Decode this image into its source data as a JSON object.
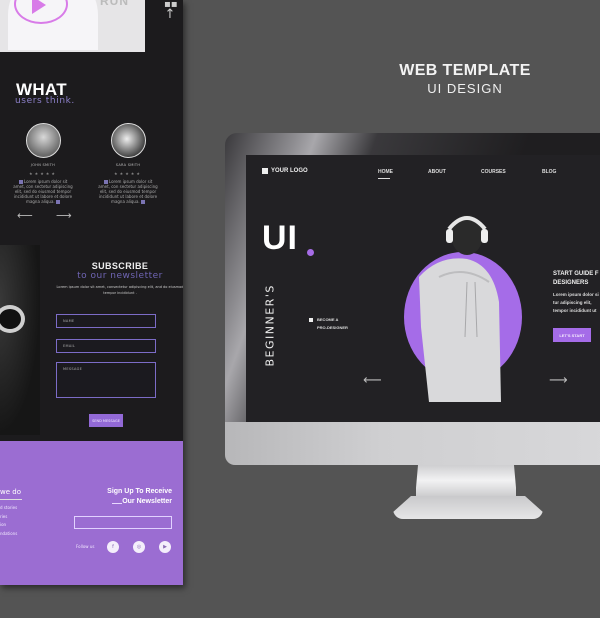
{
  "headline": {
    "title": "WEB TEMPLATE",
    "subtitle": "UI DESIGN"
  },
  "left_page": {
    "hero_ghost_text": "RUN",
    "side_icons": [
      "grid-icon",
      "arrow-up-icon"
    ],
    "testimonials": {
      "title": "WHAT",
      "subtitle": "users think.",
      "items": [
        {
          "name": "JOHN SMITH",
          "rating": 5,
          "text": "Lorem ipsum dolor sit amet, con sectetur adipiscing elit, sed do eiusmod tempor incididunt ut labore et dolore magna aliqua."
        },
        {
          "name": "SARA SMITH",
          "rating": 5,
          "text": "Lorem ipsum dolor sit amet, con sectetur adipiscing elit, sed do eiusmod tempor incididunt ut labore et dolore magna aliqua."
        }
      ],
      "prev_arrow": "⟵",
      "next_arrow": "⟶"
    },
    "subscribe": {
      "title": "SUBSCRIBE",
      "subtitle": "to our newsletter",
      "description": "Lorem ipsum dolor sit amet, consectetur adipiscing elit, and do eiusmod tempor incididunt .",
      "name_placeholder": "NAME",
      "email_placeholder": "EMAIL",
      "message_placeholder": "MESSAGE",
      "send_label": "SEND MESSAGE"
    },
    "footer": {
      "what_we_do_title": "we do",
      "what_we_do_items": [
        "d stories",
        "ries",
        "ion",
        "ndations"
      ],
      "signup_line1": "Sign Up To Receive",
      "signup_line2": "Our Newsletter",
      "follow_label": "Follow us",
      "social": [
        {
          "icon": "facebook-icon",
          "glyph": "f"
        },
        {
          "icon": "instagram-icon",
          "glyph": "◎"
        },
        {
          "icon": "youtube-icon",
          "glyph": "▶"
        }
      ]
    }
  },
  "monitor_site": {
    "logo": "YOUR LOGO",
    "nav": [
      {
        "label": "HOME",
        "active": true
      },
      {
        "label": "ABOUT",
        "active": false
      },
      {
        "label": "COURSES",
        "active": false
      },
      {
        "label": "BLOG",
        "active": false
      }
    ],
    "hero_big": "UI",
    "hero_vertical": "BEGINNER'S",
    "bullet_line1": "BECOME A",
    "bullet_line2": "PRO-DESIGNER",
    "guide_title_line1": "START GUIDE F",
    "guide_title_line2": "DESIGNERS",
    "guide_desc_line1": "Lorem ipsum dolor si",
    "guide_desc_line2": "tur adipiscing elit,",
    "guide_desc_line3": "tempor incididunt ut",
    "cta_label": "LET'S START",
    "prev_arrow": "⟵",
    "next_arrow": "⟶",
    "accent_color": "#a56ce8"
  }
}
